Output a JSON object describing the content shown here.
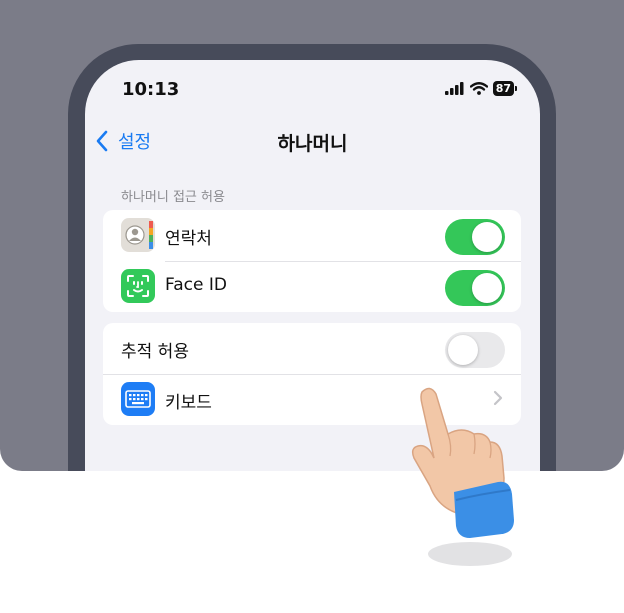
{
  "status_bar": {
    "time": "10:13",
    "battery": "87",
    "icons": [
      "cellular-signal-icon",
      "wifi-icon",
      "battery-icon"
    ]
  },
  "nav": {
    "back_label": "설정",
    "title": "하나머니"
  },
  "section": {
    "header": "하나머니 접근 허용"
  },
  "group1": [
    {
      "label": "연락처",
      "icon": "contacts-icon",
      "toggle": true
    },
    {
      "label": "Face ID",
      "icon": "face-id-icon",
      "toggle": true
    }
  ],
  "group2": [
    {
      "label": "추적 허용",
      "toggle": false
    },
    {
      "label": "키보드",
      "icon": "keyboard-icon",
      "chevron": true
    }
  ],
  "colors": {
    "accent": "#1a7bf2",
    "toggle_on": "#34c759",
    "backdrop": "#7b7c88",
    "frame": "#474b5a"
  }
}
